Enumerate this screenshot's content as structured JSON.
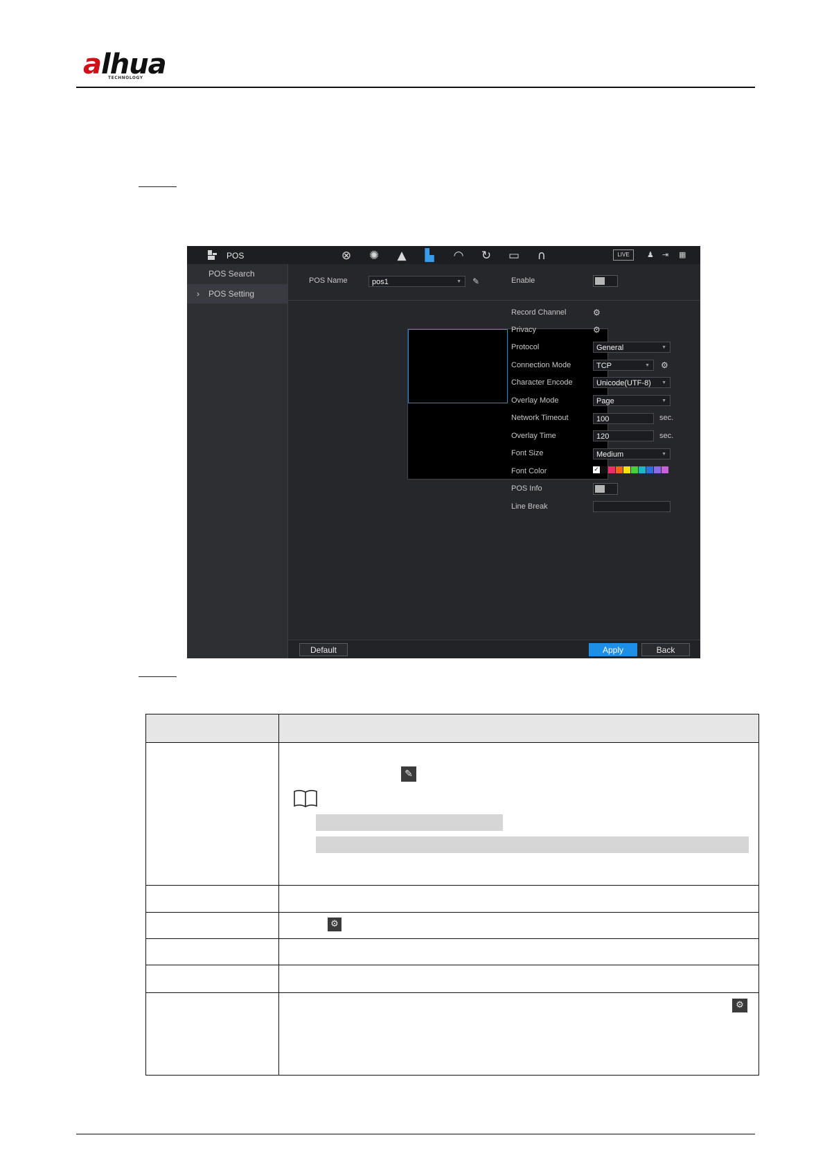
{
  "header": {
    "logo_main": "alhua",
    "logo_sub": "TECHNOLOGY"
  },
  "screenshot": {
    "module_title": "POS",
    "toolbar_icons": [
      "camera-icon",
      "network-icon",
      "alarm-icon",
      "pos-icon",
      "performance-icon",
      "backup-icon",
      "display-icon",
      "audio-icon"
    ],
    "live_badge": "LIVE",
    "sidebar": {
      "items": [
        {
          "label": "POS Search"
        },
        {
          "label": "POS Setting",
          "chevron": "›"
        }
      ]
    },
    "form": {
      "pos_name_label": "POS Name",
      "pos_name_value": "pos1",
      "enable_label": "Enable",
      "record_channel_label": "Record Channel",
      "privacy_label": "Privacy",
      "protocol_label": "Protocol",
      "protocol_value": "General",
      "connection_mode_label": "Connection Mode",
      "connection_mode_value": "TCP",
      "character_encode_label": "Character Encode",
      "character_encode_value": "Unicode(UTF-8)",
      "overlay_mode_label": "Overlay Mode",
      "overlay_mode_value": "Page",
      "network_timeout_label": "Network Timeout",
      "network_timeout_value": "100",
      "network_timeout_unit": "sec.",
      "overlay_time_label": "Overlay Time",
      "overlay_time_value": "120",
      "overlay_time_unit": "sec.",
      "font_size_label": "Font Size",
      "font_size_value": "Medium",
      "font_color_label": "Font Color",
      "font_colors": [
        "#ffffff",
        "#111111",
        "#e8306a",
        "#f06418",
        "#f3e21a",
        "#48d13b",
        "#1fb5c7",
        "#2e6de0",
        "#8a6ae6",
        "#c760d9"
      ],
      "pos_info_label": "POS Info",
      "line_break_label": "Line Break",
      "line_break_value": ""
    },
    "footer": {
      "default_label": "Default",
      "apply_label": "Apply",
      "back_label": "Back"
    },
    "colors": {
      "accent": "#1d8fe6",
      "panel": "#26272b"
    }
  },
  "table": {
    "edit_icon": "pencil-icon",
    "gear_icon": "gear-icon",
    "note_icon": "book-icon"
  }
}
